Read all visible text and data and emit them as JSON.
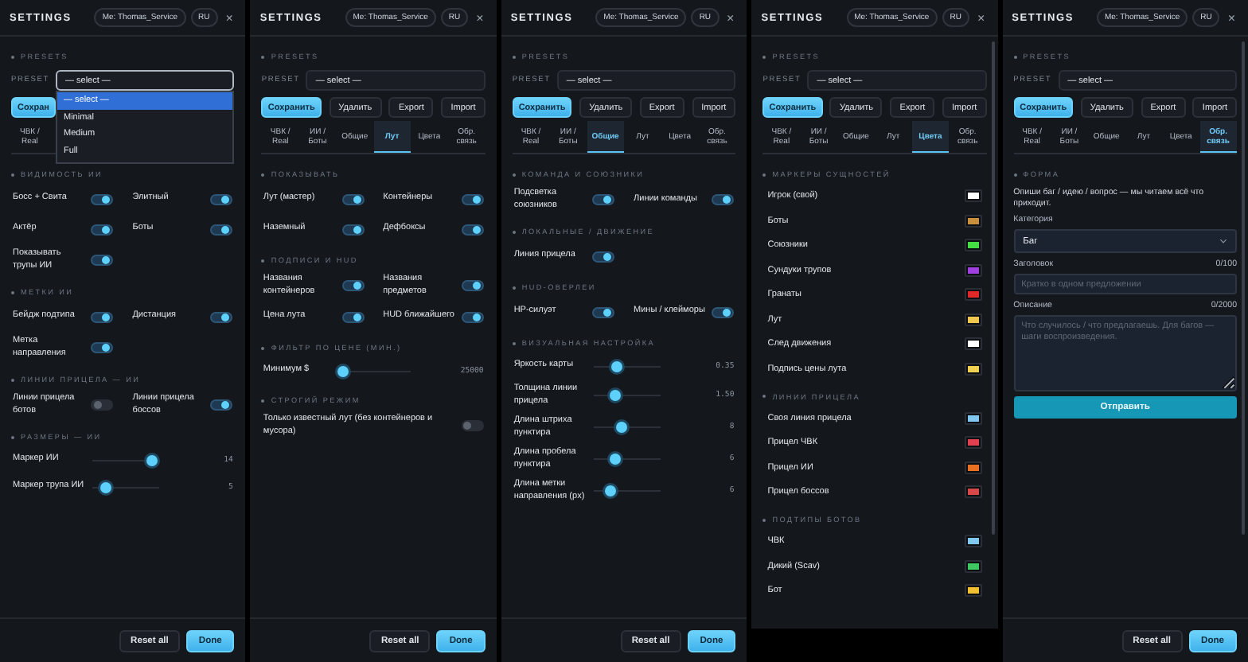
{
  "panels": [
    {
      "title": "SETTINGS",
      "user": "Me: Thomas_Service",
      "lang": "RU",
      "close": "×",
      "presets_heading": "PRESETS",
      "preset_label": "PRESET",
      "preset_value": "— select —",
      "scrollbar": false,
      "dropdown": [
        {
          "label": "— select —",
          "selected": true
        },
        {
          "label": "Minimal",
          "selected": false
        },
        {
          "label": "Medium",
          "selected": false
        },
        {
          "label": "Full",
          "selected": false
        }
      ],
      "buttons": [
        {
          "label": "Сохран",
          "kind": "primary"
        }
      ],
      "tabs": [
        {
          "label": "ЧВК / Real",
          "selected": false
        }
      ],
      "sections": [
        {
          "heading": "ВИДИМОСТЬ ИИ",
          "kind": "toggles",
          "items": [
            {
              "label": "Босс + Свита",
              "on": true
            },
            {
              "label": "Элитный",
              "on": true
            },
            {
              "label": "Актёр",
              "on": true
            },
            {
              "label": "Боты",
              "on": true
            },
            {
              "label": "Показывать трупы ИИ",
              "on": true
            }
          ]
        },
        {
          "heading": "МЕТКИ ИИ",
          "kind": "toggles",
          "items": [
            {
              "label": "Бейдж подтипа",
              "on": true
            },
            {
              "label": "Дистанция",
              "on": true
            },
            {
              "label": "Метка направления",
              "on": true
            }
          ]
        },
        {
          "heading": "ЛИНИИ ПРИЦЕЛА — ИИ",
          "kind": "toggles",
          "items": [
            {
              "label": "Линии прицела ботов",
              "on": false
            },
            {
              "label": "Линии прицела боссов",
              "on": true
            }
          ]
        },
        {
          "heading": "РАЗМЕРЫ — ИИ",
          "kind": "sliders",
          "items": [
            {
              "label": "Маркер ИИ",
              "level": 0.88,
              "reading": "14"
            },
            {
              "label": "Маркер трупа ИИ",
              "level": 0.2,
              "reading": "5"
            }
          ]
        }
      ],
      "footer": [
        "Reset all",
        "Done"
      ]
    },
    {
      "title": "SETTINGS",
      "user": "Me: Thomas_Service",
      "lang": "RU",
      "close": "×",
      "presets_heading": "PRESETS",
      "preset_label": "PRESET",
      "preset_value": "— select —",
      "scrollbar": false,
      "buttons": [
        {
          "label": "Сохранить",
          "kind": "primary"
        },
        {
          "label": "Удалить",
          "kind": "plain"
        },
        {
          "label": "Export",
          "kind": "plain"
        },
        {
          "label": "Import",
          "kind": "plain"
        }
      ],
      "tabs": [
        {
          "label": "ЧВК / Real",
          "selected": false
        },
        {
          "label": "ИИ / Боты",
          "selected": false
        },
        {
          "label": "Общие",
          "selected": false
        },
        {
          "label": "Лут",
          "selected": true
        },
        {
          "label": "Цвета",
          "selected": false
        },
        {
          "label": "Обр. связь",
          "selected": false
        }
      ],
      "sections": [
        {
          "heading": "ПОКАЗЫВАТЬ",
          "kind": "toggles",
          "items": [
            {
              "label": "Лут (мастер)",
              "on": true
            },
            {
              "label": "Контейнеры",
              "on": true
            },
            {
              "label": "Наземный",
              "on": true
            },
            {
              "label": "Дефбоксы",
              "on": true
            }
          ]
        },
        {
          "heading": "ПОДПИСИ И HUD",
          "kind": "toggles",
          "items": [
            {
              "label": "Названия контейнеров",
              "on": true
            },
            {
              "label": "Названия предметов",
              "on": true
            },
            {
              "label": "Цена лута",
              "on": true
            },
            {
              "label": "HUD ближайшего",
              "on": true
            }
          ]
        },
        {
          "heading": "ФИЛЬТР ПО ЦЕНЕ (МИН.)",
          "kind": "sliders",
          "items": [
            {
              "label": "Минимум $",
              "level": 0.0,
              "reading": "25000"
            }
          ]
        },
        {
          "heading": "СТРОГИЙ РЕЖИМ",
          "kind": "wide_toggles",
          "items": [
            {
              "label": "Только известный лут (без контейнеров и мусора)",
              "on": false
            }
          ]
        }
      ],
      "footer": [
        "Reset all",
        "Done"
      ]
    },
    {
      "title": "SETTINGS",
      "user": "Me: Thomas_Service",
      "lang": "RU",
      "close": "×",
      "presets_heading": "PRESETS",
      "preset_label": "PRESET",
      "preset_value": "— select —",
      "scrollbar": false,
      "buttons": [
        {
          "label": "Сохранить",
          "kind": "primary"
        },
        {
          "label": "Удалить",
          "kind": "plain"
        },
        {
          "label": "Export",
          "kind": "plain"
        },
        {
          "label": "Import",
          "kind": "plain"
        }
      ],
      "tabs": [
        {
          "label": "ЧВК / Real",
          "selected": false
        },
        {
          "label": "ИИ / Боты",
          "selected": false
        },
        {
          "label": "Общие",
          "selected": true
        },
        {
          "label": "Лут",
          "selected": false
        },
        {
          "label": "Цвета",
          "selected": false
        },
        {
          "label": "Обр. связь",
          "selected": false
        }
      ],
      "sections": [
        {
          "heading": "КОМАНДА И СОЮЗНИКИ",
          "kind": "toggles",
          "items": [
            {
              "label": "Подсветка союзников",
              "on": true
            },
            {
              "label": "Линии команды",
              "on": true
            }
          ]
        },
        {
          "heading": "ЛОКАЛЬНЫЕ / ДВИЖЕНИЕ",
          "kind": "toggles",
          "items": [
            {
              "label": "Линия прицела",
              "on": true
            }
          ]
        },
        {
          "heading": "HUD-ОВЕРЛЕИ",
          "kind": "toggles",
          "items": [
            {
              "label": "HP-силуэт",
              "on": true
            },
            {
              "label": "Мины / клейморы",
              "on": true
            }
          ]
        },
        {
          "heading": "ВИЗУАЛЬНАЯ НАСТРОЙКА",
          "kind": "sliders",
          "items": [
            {
              "label": "Яркость карты",
              "level": 0.35,
              "reading": "0.35"
            },
            {
              "label": "Толщина линии прицела",
              "level": 0.32,
              "reading": "1.50"
            },
            {
              "label": "Длина штриха пунктира",
              "level": 0.42,
              "reading": "8"
            },
            {
              "label": "Длина пробела пунктира",
              "level": 0.33,
              "reading": "6"
            },
            {
              "label": "Длина метки направления (px)",
              "level": 0.25,
              "reading": "6"
            }
          ]
        }
      ],
      "footer": [
        "Reset all",
        "Done"
      ]
    },
    {
      "title": "SETTINGS",
      "user": "Me: Thomas_Service",
      "lang": "RU",
      "close": "×",
      "presets_heading": "PRESETS",
      "preset_label": "PRESET",
      "preset_value": "— select —",
      "scrollbar": true,
      "buttons": [
        {
          "label": "Сохранить",
          "kind": "primary"
        },
        {
          "label": "Удалить",
          "kind": "plain"
        },
        {
          "label": "Export",
          "kind": "plain"
        },
        {
          "label": "Import",
          "kind": "plain"
        }
      ],
      "tabs": [
        {
          "label": "ЧВК / Real",
          "selected": false
        },
        {
          "label": "ИИ / Боты",
          "selected": false
        },
        {
          "label": "Общие",
          "selected": false
        },
        {
          "label": "Лут",
          "selected": false
        },
        {
          "label": "Цвета",
          "selected": true
        },
        {
          "label": "Обр. связь",
          "selected": false
        }
      ],
      "sections": [
        {
          "heading": "МАРКЕРЫ СУЩНОСТЕЙ",
          "kind": "colors",
          "items": [
            {
              "label": "Игрок (свой)",
              "color": "#ffffff"
            },
            {
              "label": "Боты",
              "color": "#c8903c"
            },
            {
              "label": "Союзники",
              "color": "#44dd44"
            },
            {
              "label": "Сундуки трупов",
              "color": "#a040e0"
            },
            {
              "label": "Гранаты",
              "color": "#e02828"
            },
            {
              "label": "Лут",
              "color": "#f0c850"
            },
            {
              "label": "След движения",
              "color": "#ffffff"
            },
            {
              "label": "Подпись цены лута",
              "color": "#f0d050"
            }
          ]
        },
        {
          "heading": "ЛИНИИ ПРИЦЕЛА",
          "kind": "colors",
          "items": [
            {
              "label": "Своя линия прицела",
              "color": "#80c8f0"
            },
            {
              "label": "Прицел ЧВК",
              "color": "#e04050"
            },
            {
              "label": "Прицел ИИ",
              "color": "#e87020"
            },
            {
              "label": "Прицел боссов",
              "color": "#d84848"
            }
          ]
        },
        {
          "heading": "ПОДТИПЫ БОТОВ",
          "kind": "colors",
          "items": [
            {
              "label": "ЧВК",
              "color": "#80c8f0"
            },
            {
              "label": "Дикий (Scav)",
              "color": "#40c860"
            },
            {
              "label": "Бот",
              "color": "#f0c030"
            }
          ]
        }
      ]
    },
    {
      "title": "SETTINGS",
      "user": "Me: Thomas_Service",
      "lang": "RU",
      "close": "×",
      "presets_heading": "PRESETS",
      "preset_label": "PRESET",
      "preset_value": "— select —",
      "scrollbar": true,
      "buttons": [
        {
          "label": "Сохранить",
          "kind": "primary"
        },
        {
          "label": "Удалить",
          "kind": "plain"
        },
        {
          "label": "Export",
          "kind": "plain"
        },
        {
          "label": "Import",
          "kind": "plain"
        }
      ],
      "tabs": [
        {
          "label": "ЧВК / Real",
          "selected": false
        },
        {
          "label": "ИИ / Боты",
          "selected": false
        },
        {
          "label": "Общие",
          "selected": false
        },
        {
          "label": "Лут",
          "selected": false
        },
        {
          "label": "Цвета",
          "selected": false
        },
        {
          "label": "Обр. связь",
          "selected": true
        }
      ],
      "sections": [
        {
          "heading": "ФОРМА",
          "kind": "form",
          "intro": "Опиши баг / идею / вопрос — мы читаем всё что приходит.",
          "category_label": "Категория",
          "category_value": "Баг",
          "title_label": "Заголовок",
          "title_counter": "0/100",
          "title_placeholder": "Кратко в одном предложении",
          "desc_label": "Описание",
          "desc_counter": "0/2000",
          "desc_placeholder": "Что случилось / что предлагаешь. Для багов — шаги воспроизведения.",
          "submit": "Отправить"
        }
      ],
      "footer": [
        "Reset all",
        "Done"
      ]
    }
  ]
}
